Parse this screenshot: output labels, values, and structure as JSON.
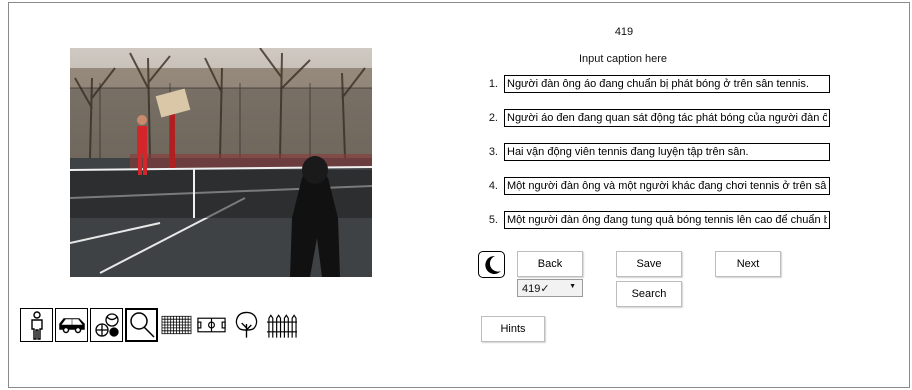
{
  "image_id": "419",
  "caption_header": "Input caption here",
  "captions": [
    {
      "number": "1.",
      "text": "Người đàn ông áo đang chuẩn bị phát bóng ở trên sân tennis."
    },
    {
      "number": "2.",
      "text": "Người áo đen đang quan sát động tác phát bóng của người đàn ông áo đỏ."
    },
    {
      "number": "3.",
      "text": "Hai vận động viên tennis đang luyện tập trên sân."
    },
    {
      "number": "4.",
      "text": "Một người đàn ông và một người khác đang chơi tennis ở trên sân."
    },
    {
      "number": "5.",
      "text": "Một người đàn ông đang tung quả bóng tennis lên cao để chuẩn bị phát bóng."
    }
  ],
  "buttons": {
    "back": "Back",
    "save": "Save",
    "next": "Next",
    "search": "Search",
    "hints": "Hints"
  },
  "image_select": {
    "selected": "419✓"
  },
  "category_icons": [
    "person-icon",
    "car-icon",
    "sports-balls-icon",
    "tennis-racket-icon",
    "net-icon",
    "field-icon",
    "tree-icon",
    "fence-icon"
  ],
  "selected_category": "tennis-racket-icon",
  "colors": {
    "border": "#000000",
    "frame": "#8a8a8a",
    "button_border": "#bdbdbd"
  }
}
